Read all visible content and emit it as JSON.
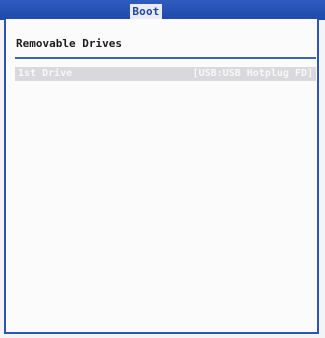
{
  "header": {
    "active_tab": "Boot"
  },
  "section": {
    "title": "Removable Drives"
  },
  "drives": [
    {
      "label": "1st Drive",
      "value": "[USB:USB Hotplug FD]"
    }
  ],
  "colors": {
    "bar": "#2f5dbf",
    "frame": "#2b56b6",
    "row_highlight": "#d9d9dd",
    "text_dark": "#1c1c1c",
    "text_light": "#f7f7f7"
  }
}
